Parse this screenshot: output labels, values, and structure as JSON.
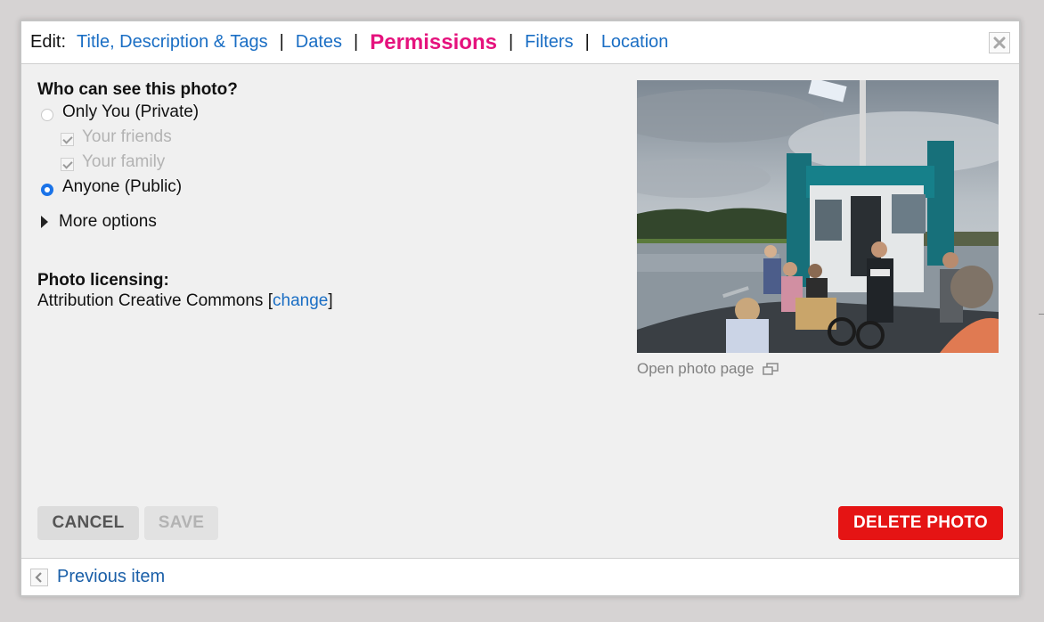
{
  "tabbar": {
    "edit_label": "Edit:",
    "tabs": [
      {
        "label": "Title, Description & Tags",
        "active": false
      },
      {
        "label": "Dates",
        "active": false
      },
      {
        "label": "Permissions",
        "active": true
      },
      {
        "label": "Filters",
        "active": false
      },
      {
        "label": "Location",
        "active": false
      }
    ],
    "separator": "|"
  },
  "visibility": {
    "heading": "Who can see this photo?",
    "private_label": "Only You (Private)",
    "friends_label": "Your friends",
    "family_label": "Your family",
    "public_label": "Anyone (Public)",
    "selected": "public",
    "friends_checked": true,
    "family_checked": true
  },
  "more_options": {
    "label": "More options"
  },
  "licensing": {
    "heading": "Photo licensing:",
    "value": "Attribution Creative Commons",
    "open_bracket": "[",
    "change_label": "change",
    "close_bracket": "]"
  },
  "photo": {
    "icon": "photo-thumbnail",
    "open_label": "Open photo page"
  },
  "actions": {
    "cancel_label": "CANCEL",
    "save_label": "SAVE",
    "delete_label": "DELETE PHOTO"
  },
  "footer": {
    "previous_label": "Previous item"
  },
  "colors": {
    "link": "#1a6ec4",
    "active_tab": "#e5127d",
    "delete": "#e51414",
    "radio_selected": "#1a73e8",
    "panel_bg": "#f0f0f0"
  }
}
